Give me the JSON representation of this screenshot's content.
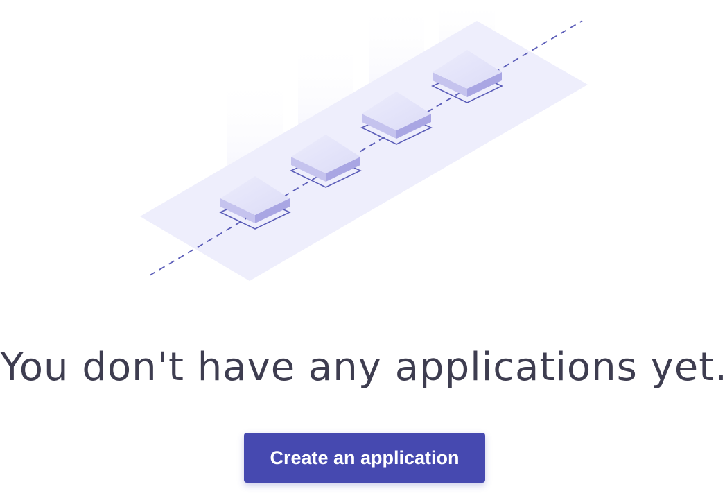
{
  "empty_state": {
    "title": "You don't have any applications yet.",
    "button_label": "Create an application"
  },
  "illustration": {
    "icon_name": "isometric-server-boxes-illustration",
    "box_count": 4
  },
  "colors": {
    "accent": "#4649b0",
    "title_text": "#3e3d50",
    "platform": "#eeeefc",
    "dash_line": "#5a5cb8",
    "box_top": "#e4e4fa",
    "box_side": "#b8b6ea"
  }
}
